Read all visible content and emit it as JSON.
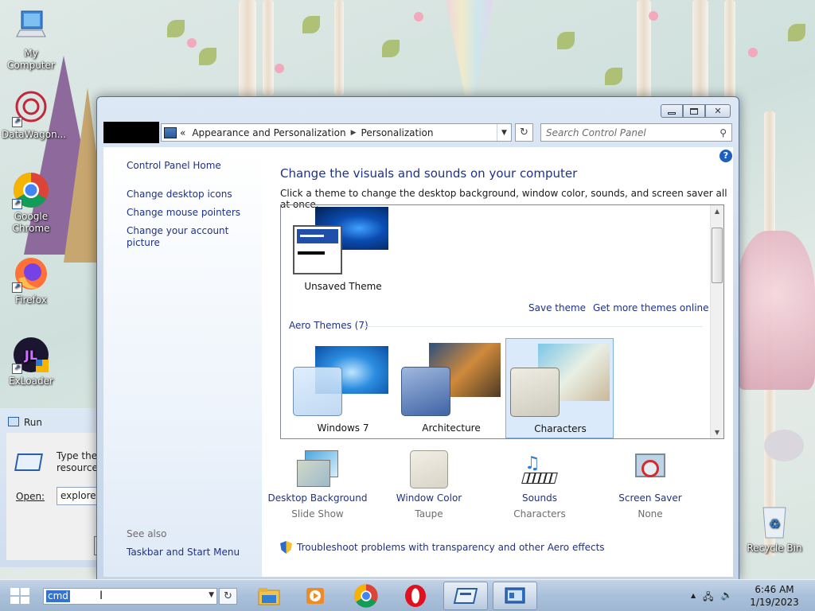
{
  "desktop": {
    "icons": [
      {
        "label": "My Computer"
      },
      {
        "label": "DataWagon..."
      },
      {
        "label": "Google Chrome"
      },
      {
        "label": "Firefox"
      },
      {
        "label": "ExLoader"
      },
      {
        "label": "Recycle Bin"
      }
    ]
  },
  "window": {
    "breadcrumb": {
      "prefix": "«",
      "items": [
        "Appearance and Personalization",
        "Personalization"
      ]
    },
    "search_placeholder": "Search Control Panel",
    "left_pane": {
      "home": "Control Panel Home",
      "links": [
        "Change desktop icons",
        "Change mouse pointers",
        "Change your account picture"
      ],
      "see_also_title": "See also",
      "see_also": [
        "Taskbar and Start Menu"
      ]
    },
    "main": {
      "heading": "Change the visuals and sounds on your computer",
      "subheading": "Click a theme to change the desktop background, window color, sounds, and screen saver all at once.",
      "unsaved_theme": "Unsaved Theme",
      "save_theme": "Save theme",
      "get_more": "Get more themes online",
      "group_title": "Aero Themes (7)",
      "themes": [
        "Windows 7",
        "Architecture",
        "Characters"
      ],
      "selected_theme": "Characters",
      "settings": [
        {
          "title": "Desktop Background",
          "value": "Slide Show"
        },
        {
          "title": "Window Color",
          "value": "Taupe"
        },
        {
          "title": "Sounds",
          "value": "Characters"
        },
        {
          "title": "Screen Saver",
          "value": "None"
        }
      ],
      "troubleshoot": "Troubleshoot problems with transparency and other Aero effects"
    }
  },
  "run_dialog": {
    "title": "Run",
    "text_line1": "Type the",
    "text_line2": "resource,",
    "open_label": "Open:",
    "open_value": "explorer"
  },
  "taskbar": {
    "address_value": "cmd",
    "time": "6:46 AM",
    "date": "1/19/2023"
  },
  "colors": {
    "link": "#1e3287",
    "accent": "#3374d2",
    "taskbar": "#aac0da"
  }
}
